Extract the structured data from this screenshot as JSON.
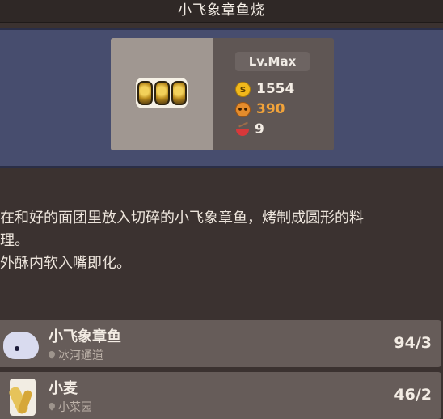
{
  "header": {
    "title": "小飞象章鱼烧"
  },
  "dish": {
    "level": "Lv.Max",
    "price": "1554",
    "satisfaction": "390",
    "stock": "9",
    "colors": {
      "price": "#f3ece4",
      "satisfaction": "#f2a33a",
      "stock": "#f3ece4"
    }
  },
  "description": {
    "line1": "在和好的面团里放入切碎的小飞象章鱼，烤制成圆形的料",
    "line2": "理。",
    "line3": "外酥内软入嘴即化。"
  },
  "ingredients": [
    {
      "name": "小飞象章鱼",
      "location": "冰河通道",
      "count": "94/3",
      "icon": "cloud-octopus-icon"
    },
    {
      "name": "小麦",
      "location": "小菜园",
      "count": "46/2",
      "icon": "wheat-icon"
    }
  ]
}
